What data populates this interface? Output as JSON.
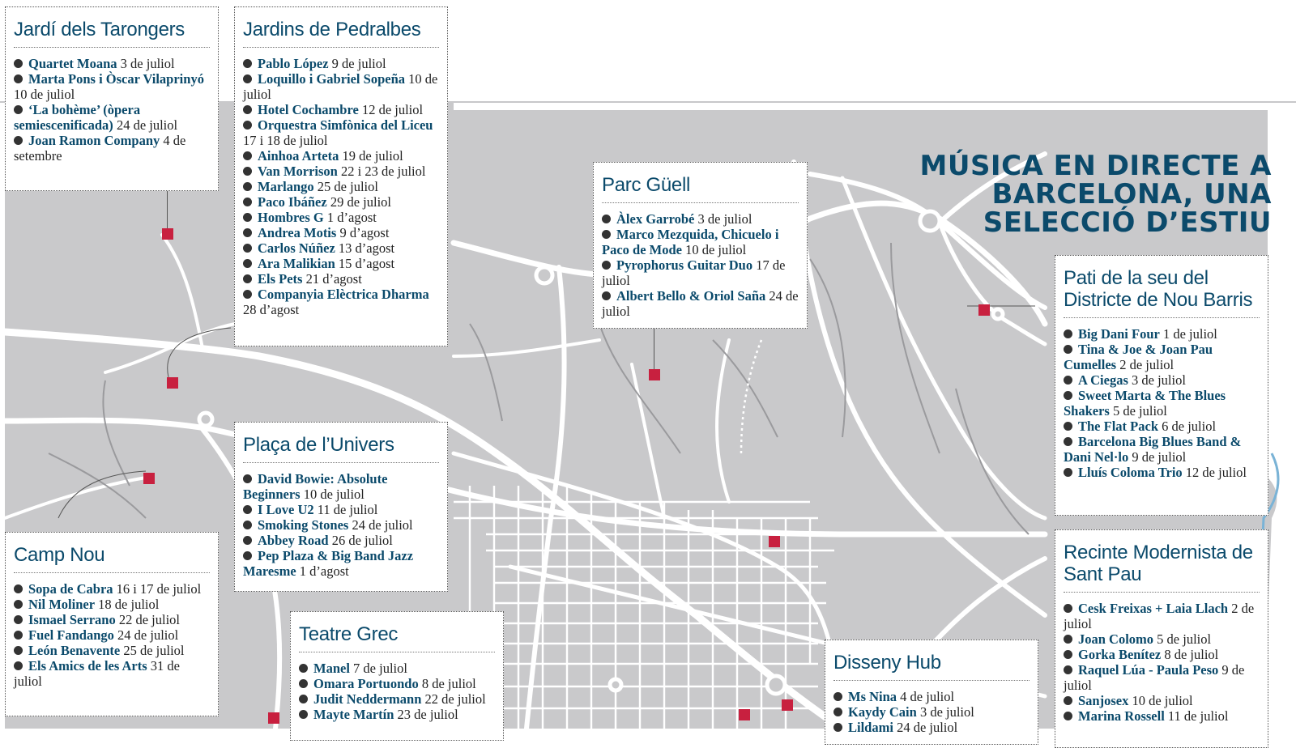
{
  "title": [
    "MÚSICA EN DIRECTE A",
    "BARCELONA, UNA",
    "SELECCIÓ D’ESTIU"
  ],
  "colors": {
    "accent": "#0b4a6b",
    "marker": "#c8203f",
    "map_background": "#c9c9cb",
    "streets": "#ffffff"
  },
  "venues": [
    {
      "name": "Jardí dels Tarongers",
      "events": [
        {
          "artist": "Quartet Moana",
          "date": "3 de juliol"
        },
        {
          "artist": "Marta Pons i Òscar Vilaprinyó",
          "date": "10 de juliol"
        },
        {
          "artist": "‘La bohème’ (òpera semiescenificada)",
          "date": "24 de juliol"
        },
        {
          "artist": "Joan Ramon Company",
          "date": "4 de setembre"
        }
      ]
    },
    {
      "name": "Jardins de Pedralbes",
      "events": [
        {
          "artist": "Pablo López",
          "date": "9 de juliol"
        },
        {
          "artist": "Loquillo i Gabriel Sopeña",
          "date": "10 de juliol"
        },
        {
          "artist": "Hotel Cochambre",
          "date": "12 de juliol"
        },
        {
          "artist": "Orquestra Simfònica del Liceu",
          "date": "17 i 18 de juliol"
        },
        {
          "artist": "Ainhoa Arteta",
          "date": "19 de juliol"
        },
        {
          "artist": "Van Morrison",
          "date": "22 i 23 de juliol"
        },
        {
          "artist": "Marlango",
          "date": "25 de juliol"
        },
        {
          "artist": "Paco Ibáñez",
          "date": "29 de juliol"
        },
        {
          "artist": "Hombres G",
          "date": "1 d’agost"
        },
        {
          "artist": "Andrea Motis",
          "date": "9 d’agost"
        },
        {
          "artist": "Carlos Núñez",
          "date": "13 d’agost"
        },
        {
          "artist": "Ara Malikian",
          "date": "15 d’agost"
        },
        {
          "artist": "Els Pets",
          "date": "21 d’agost"
        },
        {
          "artist": "Companyia Elèctrica Dharma",
          "date": "28 d’agost"
        }
      ]
    },
    {
      "name": "Parc Güell",
      "events": [
        {
          "artist": "Àlex Garrobé",
          "date": "3 de juliol"
        },
        {
          "artist": "Marco Mezquida, Chicuelo i Paco de Mode",
          "date": "10 de juliol"
        },
        {
          "artist": "Pyrophorus Guitar Duo",
          "date": "17 de juliol"
        },
        {
          "artist": "Albert Bello & Oriol Saña",
          "date": "24 de juliol"
        }
      ]
    },
    {
      "name": "Pati de la seu del Districte de Nou Barris",
      "events": [
        {
          "artist": "Big Dani Four",
          "date": "1 de juliol"
        },
        {
          "artist": "Tina & Joe & Joan Pau Cumelles",
          "date": "2 de juliol"
        },
        {
          "artist": "A Ciegas",
          "date": "3 de juliol"
        },
        {
          "artist": "Sweet Marta & The Blues Shakers",
          "date": "5 de juliol"
        },
        {
          "artist": "The Flat Pack",
          "date": "6 de juliol"
        },
        {
          "artist": "Barcelona Big Blues Band & Dani Nel·lo",
          "date": "9 de juliol"
        },
        {
          "artist": "Lluís Coloma Trio",
          "date": "12 de juliol"
        }
      ]
    },
    {
      "name": "Plaça de l’Univers",
      "events": [
        {
          "artist": "David Bowie: Absolute Beginners",
          "date": "10 de juliol"
        },
        {
          "artist": "I Love U2",
          "date": "11 de juliol"
        },
        {
          "artist": "Smoking Stones",
          "date": "24 de juliol"
        },
        {
          "artist": "Abbey Road",
          "date": "26 de juliol"
        },
        {
          "artist": "Pep Plaza & Big Band Jazz Maresme",
          "date": "1 d’agost"
        }
      ]
    },
    {
      "name": "Camp Nou",
      "events": [
        {
          "artist": "Sopa de Cabra",
          "date": "16 i 17 de juliol"
        },
        {
          "artist": "Nil Moliner",
          "date": "18 de juliol"
        },
        {
          "artist": "Ismael Serrano",
          "date": "22 de juliol"
        },
        {
          "artist": "Fuel Fandango",
          "date": "24 de juliol"
        },
        {
          "artist": "León Benavente",
          "date": "25 de juliol"
        },
        {
          "artist": "Els Amics de les Arts",
          "date": "31 de juliol"
        }
      ]
    },
    {
      "name": "Teatre Grec",
      "events": [
        {
          "artist": "Manel",
          "date": "7 de juliol"
        },
        {
          "artist": "Omara Portuondo",
          "date": "8 de juliol"
        },
        {
          "artist": "Judit Neddermann",
          "date": "22 de juliol"
        },
        {
          "artist": "Mayte Martín",
          "date": "23 de juliol"
        }
      ]
    },
    {
      "name": "Disseny Hub",
      "events": [
        {
          "artist": "Ms Nina",
          "date": "4 de juliol"
        },
        {
          "artist": "Kaydy Cain",
          "date": "3 de juliol"
        },
        {
          "artist": "Lildami",
          "date": "24 de juliol"
        }
      ]
    },
    {
      "name": "Recinte Modernista de Sant Pau",
      "events": [
        {
          "artist": "Cesk Freixas + Laia Llach",
          "date": "2 de juliol"
        },
        {
          "artist": "Joan Colomo",
          "date": "5 de juliol"
        },
        {
          "artist": "Gorka Benítez",
          "date": "8 de juliol"
        },
        {
          "artist": "Raquel Lúa - Paula Peso",
          "date": "9 de juliol"
        },
        {
          "artist": "Sanjosex",
          "date": "10 de juliol"
        },
        {
          "artist": "Marina Rossell",
          "date": "11 de juliol"
        }
      ]
    }
  ]
}
